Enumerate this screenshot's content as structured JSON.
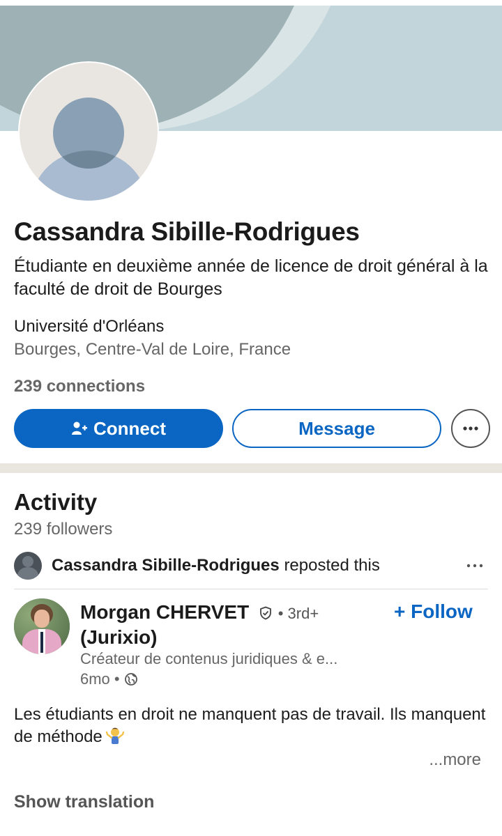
{
  "profile": {
    "name": "Cassandra Sibille-Rodrigues",
    "headline": "Étudiante en deuxième année de licence de droit général à la faculté de droit de Bourges",
    "school": "Université d'Orléans",
    "location": "Bourges, Centre-Val de Loire, France",
    "connections": "239 connections"
  },
  "actions": {
    "connect_label": "Connect",
    "message_label": "Message",
    "more_icon": "ellipsis-icon"
  },
  "activity": {
    "title": "Activity",
    "followers": "239 followers",
    "repost": {
      "name": "Cassandra Sibille-Rodrigues",
      "action": "reposted this"
    },
    "post": {
      "author_name": "Morgan CHERVET",
      "author_suffix": "(Jurixio)",
      "degree": "• 3rd+",
      "follow_label": "+ Follow",
      "description": "Créateur de contenus juridiques & e...",
      "time": "6mo •",
      "text": "Les étudiants en droit ne manquent pas de travail. Ils manquent de méthode",
      "more": "...more",
      "show_translation": "Show translation"
    }
  },
  "colors": {
    "brand_blue": "#0a66c2",
    "banner": "#c1d5da",
    "divider": "#e9e6e0"
  }
}
